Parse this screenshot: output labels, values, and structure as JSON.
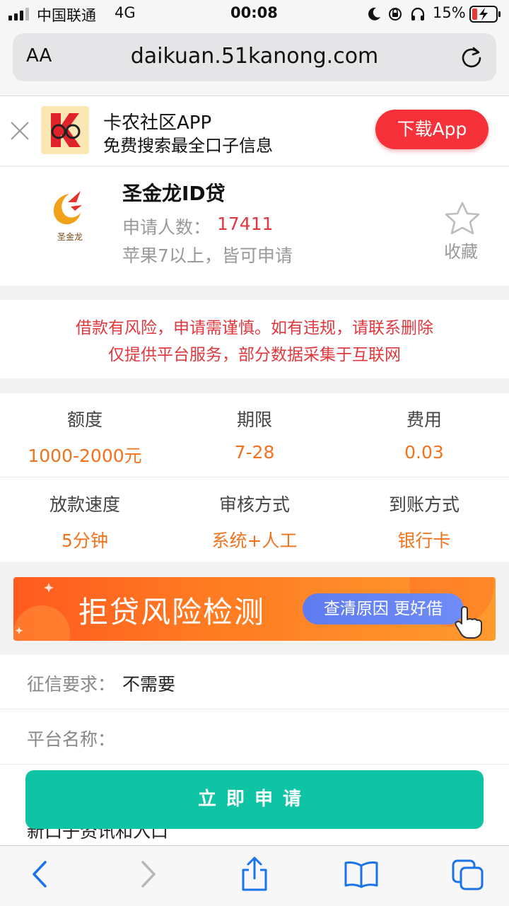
{
  "status_bar": {
    "carrier": "中国联通",
    "network": "4G",
    "time": "00:08",
    "battery": "15%"
  },
  "browser": {
    "text_size_label": "AA",
    "url": "daikuan.51kanong.com"
  },
  "app_banner": {
    "title": "卡农社区APP",
    "subtitle": "免费搜索最全口子信息",
    "download_label": "下载App"
  },
  "product": {
    "name": "圣金龙ID贷",
    "applicants_label": "申请人数：",
    "applicants_count": "17411",
    "requirement": "苹果7以上，皆可申请",
    "favorite_label": "收藏",
    "logo_text": "圣金龙"
  },
  "notice": {
    "line1": "借款有风险，申请需谨慎。如有违规，请联系删除",
    "line2": "仅提供平台服务，部分数据采集于互联网"
  },
  "stats": [
    {
      "label": "额度",
      "value": "1000-2000元"
    },
    {
      "label": "期限",
      "value": "7-28"
    },
    {
      "label": "费用",
      "value": "0.03"
    },
    {
      "label": "放款速度",
      "value": "5分钟"
    },
    {
      "label": "审核方式",
      "value": "系统+人工"
    },
    {
      "label": "到账方式",
      "value": "银行卡"
    }
  ],
  "promo": {
    "title": "拒贷风险检测",
    "pill": "查清原因 更好借"
  },
  "info": {
    "credit_label": "征信要求：",
    "credit_value": "不需要",
    "platform_label": "平台名称：",
    "partial_text": "新口子资讯和入口"
  },
  "apply_button": "立即申请",
  "colors": {
    "accent_orange": "#f2731d",
    "notice_red": "#e0383e",
    "download_red": "#f7313a",
    "apply_teal": "#0ec4a5",
    "ios_blue": "#1a73e8"
  }
}
